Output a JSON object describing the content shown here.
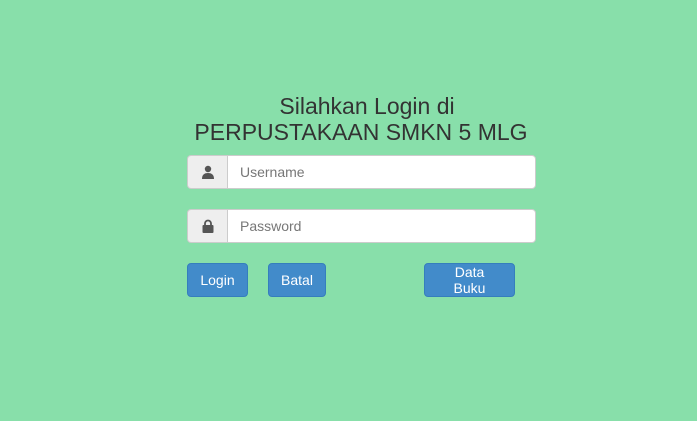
{
  "heading": {
    "line1": "Silahkan Login di",
    "line2": "PERPUSTAKAAN SMKN 5 MLG"
  },
  "form": {
    "username": {
      "icon": "user-icon",
      "placeholder": "Username",
      "value": ""
    },
    "password": {
      "icon": "lock-icon",
      "placeholder": "Password",
      "value": ""
    }
  },
  "buttons": {
    "login": "Login",
    "cancel": "Batal",
    "book_data": "Data Buku"
  },
  "colors": {
    "background": "#88dfaa",
    "primary": "#428bca",
    "text": "#333333"
  }
}
